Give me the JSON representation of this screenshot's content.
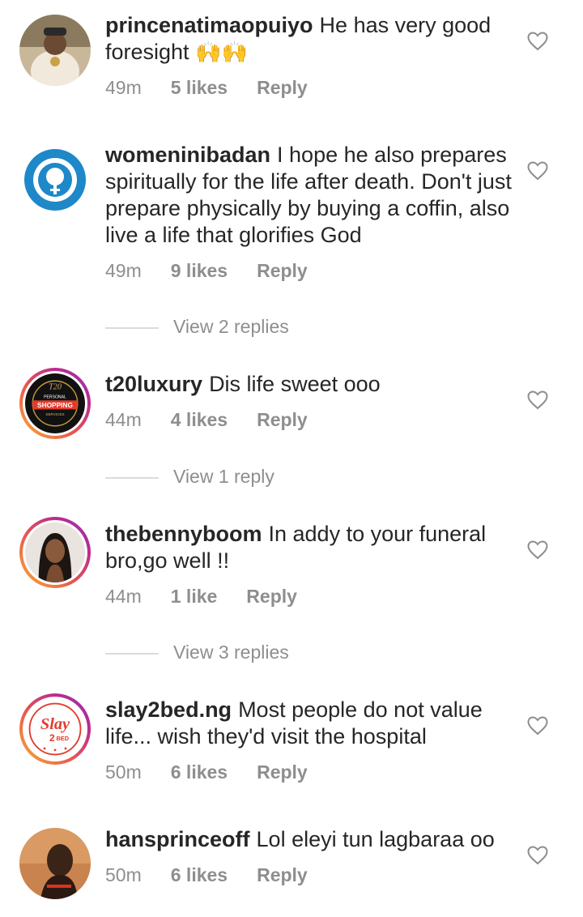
{
  "comments": [
    {
      "username": "princenatimaopuiyo",
      "text": "He has very good foresight",
      "emoji": "🙌🙌",
      "time": "49m",
      "likes": "5 likes",
      "reply": "Reply"
    },
    {
      "username": "womeninibadan",
      "text": "I hope he also prepares spiritually for the life after death. Don't just prepare physically by buying a coffin, also live a life that glorifies God",
      "time": "49m",
      "likes": "9 likes",
      "reply": "Reply",
      "view_replies": "View 2 replies"
    },
    {
      "username": "t20luxury",
      "text": "Dis life sweet ooo",
      "time": "44m",
      "likes": "4 likes",
      "reply": "Reply",
      "view_replies": "View 1 reply",
      "avatar_text": {
        "line1": "PERSONAL",
        "line2": "SHOPPING",
        "line3": "SERVICES"
      }
    },
    {
      "username": "thebennyboom",
      "text": "In addy to your funeral bro,go well !!",
      "time": "44m",
      "likes": "1 like",
      "reply": "Reply",
      "view_replies": "View 3 replies"
    },
    {
      "username": "slay2bed.ng",
      "text": "Most people do not value life... wish they'd visit the hospital",
      "time": "50m",
      "likes": "6 likes",
      "reply": "Reply"
    },
    {
      "username": "hansprinceoff",
      "text": "Lol eleyi tun lagbaraa oo",
      "time": "50m",
      "likes": "6 likes",
      "reply": "Reply"
    }
  ],
  "colors": {
    "text": "#262626",
    "secondary": "#8e8e8e",
    "divider": "#dbdbdb",
    "story_ring_start": "#f9b233",
    "story_ring_end": "#8a3ab9",
    "womeninibadan_brand": "#1e88c8"
  },
  "icons": {
    "like": "heart-outline-icon"
  }
}
